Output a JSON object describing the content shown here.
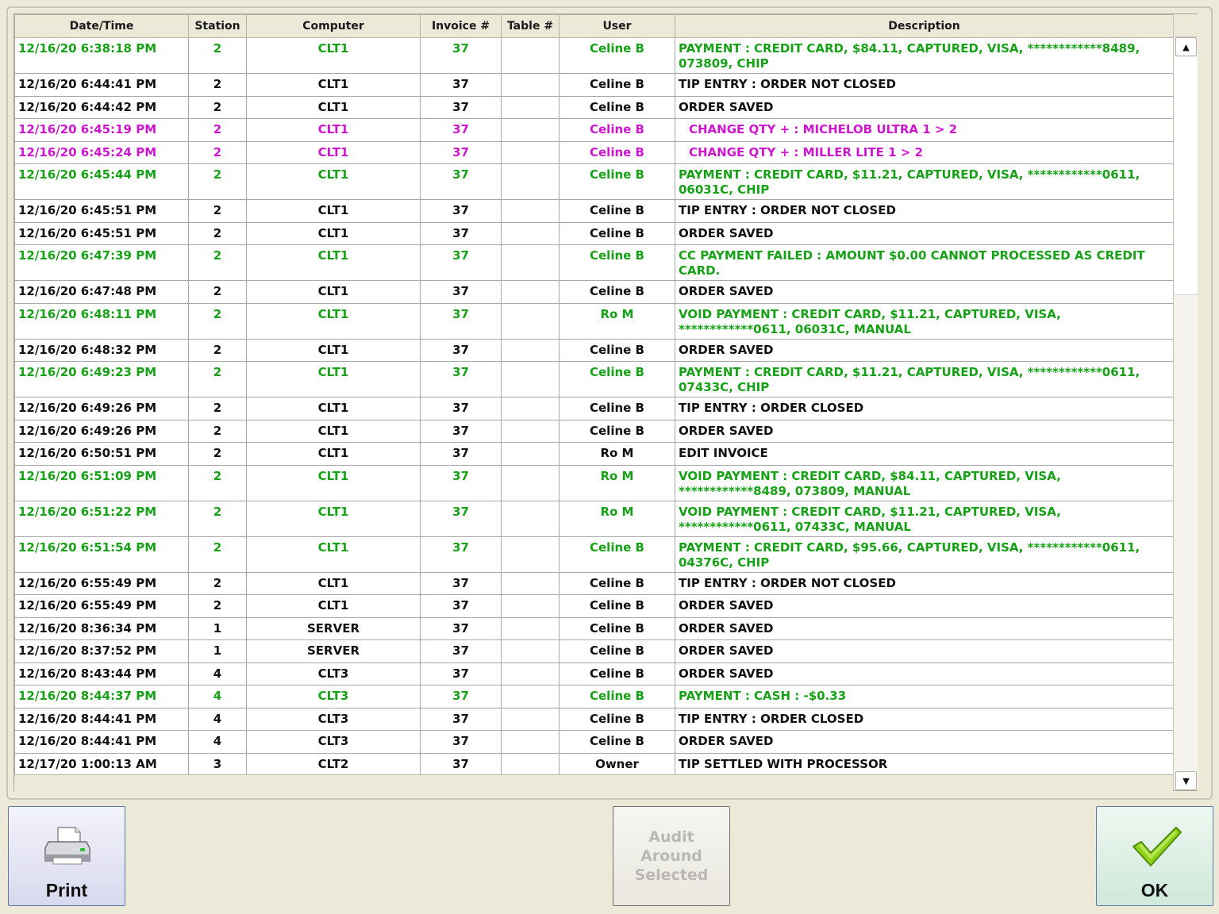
{
  "columns": {
    "datetime": "Date/Time",
    "station": "Station",
    "computer": "Computer",
    "invoice": "Invoice #",
    "table": "Table #",
    "user": "User",
    "description": "Description"
  },
  "colors": {
    "normal": "#111111",
    "payment": "#16a116",
    "item_change": "#cf16cf"
  },
  "rows": [
    {
      "style": "green",
      "tall": true,
      "datetime": "12/16/20 6:38:18 PM",
      "station": "2",
      "computer": "CLT1",
      "invoice": "37",
      "table": "",
      "user": "Celine B",
      "description": "PAYMENT : CREDIT CARD, $84.11, CAPTURED, VISA, ************8489, 073809, CHIP"
    },
    {
      "style": "black",
      "tall": false,
      "datetime": "12/16/20 6:44:41 PM",
      "station": "2",
      "computer": "CLT1",
      "invoice": "37",
      "table": "",
      "user": "Celine B",
      "description": "TIP ENTRY : ORDER NOT CLOSED"
    },
    {
      "style": "black",
      "tall": false,
      "datetime": "12/16/20 6:44:42 PM",
      "station": "2",
      "computer": "CLT1",
      "invoice": "37",
      "table": "",
      "user": "Celine B",
      "description": "ORDER SAVED"
    },
    {
      "style": "magenta",
      "tall": false,
      "indent": true,
      "datetime": "12/16/20 6:45:19 PM",
      "station": "2",
      "computer": "CLT1",
      "invoice": "37",
      "table": "",
      "user": "Celine B",
      "description": "CHANGE QTY + : MICHELOB ULTRA 1 > 2"
    },
    {
      "style": "magenta",
      "tall": false,
      "indent": true,
      "datetime": "12/16/20 6:45:24 PM",
      "station": "2",
      "computer": "CLT1",
      "invoice": "37",
      "table": "",
      "user": "Celine B",
      "description": "CHANGE QTY + : MILLER LITE 1 > 2"
    },
    {
      "style": "green",
      "tall": true,
      "datetime": "12/16/20 6:45:44 PM",
      "station": "2",
      "computer": "CLT1",
      "invoice": "37",
      "table": "",
      "user": "Celine B",
      "description": "PAYMENT : CREDIT CARD, $11.21, CAPTURED, VISA, ************0611, 06031C, CHIP"
    },
    {
      "style": "black",
      "tall": false,
      "datetime": "12/16/20 6:45:51 PM",
      "station": "2",
      "computer": "CLT1",
      "invoice": "37",
      "table": "",
      "user": "Celine B",
      "description": "TIP ENTRY : ORDER NOT CLOSED"
    },
    {
      "style": "black",
      "tall": false,
      "datetime": "12/16/20 6:45:51 PM",
      "station": "2",
      "computer": "CLT1",
      "invoice": "37",
      "table": "",
      "user": "Celine B",
      "description": "ORDER SAVED"
    },
    {
      "style": "green",
      "tall": true,
      "datetime": "12/16/20 6:47:39 PM",
      "station": "2",
      "computer": "CLT1",
      "invoice": "37",
      "table": "",
      "user": "Celine B",
      "description": "CC PAYMENT FAILED : AMOUNT $0.00 CANNOT PROCESSED AS CREDIT CARD."
    },
    {
      "style": "black",
      "tall": false,
      "datetime": "12/16/20 6:47:48 PM",
      "station": "2",
      "computer": "CLT1",
      "invoice": "37",
      "table": "",
      "user": "Celine B",
      "description": "ORDER SAVED"
    },
    {
      "style": "green",
      "tall": true,
      "datetime": "12/16/20 6:48:11 PM",
      "station": "2",
      "computer": "CLT1",
      "invoice": "37",
      "table": "",
      "user": "Ro M",
      "description": "VOID PAYMENT : CREDIT CARD, $11.21, CAPTURED, VISA, ************0611, 06031C, MANUAL"
    },
    {
      "style": "black",
      "tall": false,
      "datetime": "12/16/20 6:48:32 PM",
      "station": "2",
      "computer": "CLT1",
      "invoice": "37",
      "table": "",
      "user": "Celine B",
      "description": "ORDER SAVED"
    },
    {
      "style": "green",
      "tall": true,
      "datetime": "12/16/20 6:49:23 PM",
      "station": "2",
      "computer": "CLT1",
      "invoice": "37",
      "table": "",
      "user": "Celine B",
      "description": "PAYMENT : CREDIT CARD, $11.21, CAPTURED, VISA, ************0611, 07433C, CHIP"
    },
    {
      "style": "black",
      "tall": false,
      "datetime": "12/16/20 6:49:26 PM",
      "station": "2",
      "computer": "CLT1",
      "invoice": "37",
      "table": "",
      "user": "Celine B",
      "description": "TIP ENTRY : ORDER CLOSED"
    },
    {
      "style": "black",
      "tall": false,
      "datetime": "12/16/20 6:49:26 PM",
      "station": "2",
      "computer": "CLT1",
      "invoice": "37",
      "table": "",
      "user": "Celine B",
      "description": "ORDER SAVED"
    },
    {
      "style": "black",
      "tall": false,
      "datetime": "12/16/20 6:50:51 PM",
      "station": "2",
      "computer": "CLT1",
      "invoice": "37",
      "table": "",
      "user": "Ro M",
      "description": "EDIT INVOICE"
    },
    {
      "style": "green",
      "tall": true,
      "datetime": "12/16/20 6:51:09 PM",
      "station": "2",
      "computer": "CLT1",
      "invoice": "37",
      "table": "",
      "user": "Ro M",
      "description": "VOID PAYMENT : CREDIT CARD, $84.11, CAPTURED, VISA, ************8489, 073809, MANUAL"
    },
    {
      "style": "green",
      "tall": true,
      "datetime": "12/16/20 6:51:22 PM",
      "station": "2",
      "computer": "CLT1",
      "invoice": "37",
      "table": "",
      "user": "Ro M",
      "description": "VOID PAYMENT : CREDIT CARD, $11.21, CAPTURED, VISA, ************0611, 07433C, MANUAL"
    },
    {
      "style": "green",
      "tall": true,
      "datetime": "12/16/20 6:51:54 PM",
      "station": "2",
      "computer": "CLT1",
      "invoice": "37",
      "table": "",
      "user": "Celine B",
      "description": "PAYMENT : CREDIT CARD, $95.66, CAPTURED, VISA, ************0611, 04376C, CHIP"
    },
    {
      "style": "black",
      "tall": false,
      "datetime": "12/16/20 6:55:49 PM",
      "station": "2",
      "computer": "CLT1",
      "invoice": "37",
      "table": "",
      "user": "Celine B",
      "description": "TIP ENTRY : ORDER NOT CLOSED"
    },
    {
      "style": "black",
      "tall": false,
      "datetime": "12/16/20 6:55:49 PM",
      "station": "2",
      "computer": "CLT1",
      "invoice": "37",
      "table": "",
      "user": "Celine B",
      "description": "ORDER SAVED"
    },
    {
      "style": "black",
      "tall": false,
      "datetime": "12/16/20 8:36:34 PM",
      "station": "1",
      "computer": "SERVER",
      "invoice": "37",
      "table": "",
      "user": "Celine B",
      "description": "ORDER SAVED"
    },
    {
      "style": "black",
      "tall": false,
      "datetime": "12/16/20 8:37:52 PM",
      "station": "1",
      "computer": "SERVER",
      "invoice": "37",
      "table": "",
      "user": "Celine B",
      "description": "ORDER SAVED"
    },
    {
      "style": "black",
      "tall": false,
      "datetime": "12/16/20 8:43:44 PM",
      "station": "4",
      "computer": "CLT3",
      "invoice": "37",
      "table": "",
      "user": "Celine B",
      "description": "ORDER SAVED"
    },
    {
      "style": "green",
      "tall": false,
      "datetime": "12/16/20 8:44:37 PM",
      "station": "4",
      "computer": "CLT3",
      "invoice": "37",
      "table": "",
      "user": "Celine B",
      "description": "PAYMENT : CASH : -$0.33"
    },
    {
      "style": "black",
      "tall": false,
      "datetime": "12/16/20 8:44:41 PM",
      "station": "4",
      "computer": "CLT3",
      "invoice": "37",
      "table": "",
      "user": "Celine B",
      "description": "TIP ENTRY : ORDER CLOSED"
    },
    {
      "style": "black",
      "tall": false,
      "datetime": "12/16/20 8:44:41 PM",
      "station": "4",
      "computer": "CLT3",
      "invoice": "37",
      "table": "",
      "user": "Celine B",
      "description": "ORDER SAVED"
    },
    {
      "style": "black",
      "tall": false,
      "datetime": "12/17/20 1:00:13 AM",
      "station": "3",
      "computer": "CLT2",
      "invoice": "37",
      "table": "",
      "user": "Owner",
      "description": "TIP SETTLED WITH PROCESSOR"
    }
  ],
  "scrollbar": {
    "up_icon": "triangle-up-icon",
    "down_icon": "triangle-down-icon"
  },
  "buttons": {
    "print": {
      "label": "Print",
      "icon": "printer-icon"
    },
    "audit": {
      "label": "Audit\nAround\nSelected",
      "enabled": false
    },
    "ok": {
      "label": "OK",
      "icon": "checkmark-icon"
    }
  }
}
